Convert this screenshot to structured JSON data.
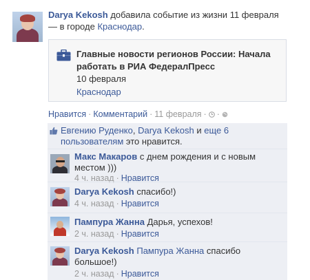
{
  "post": {
    "author": "Darya Kekosh",
    "action": "добавила событие из жизни",
    "date": "11 февраля",
    "location_prefix": "— в городе",
    "city": "Краснодар"
  },
  "event": {
    "icon": "briefcase-icon",
    "title": "Главные новости регионов России: Начала работать в РИА ФедералПресс",
    "date": "10 февраля",
    "location": "Краснодар"
  },
  "actions": {
    "like": "Нравится",
    "comment": "Комментарий",
    "date": "11 февраля"
  },
  "likes": {
    "name1": "Евгению Руденко",
    "name2": "Darya Kekosh",
    "and_word": "и",
    "more": "еще 6 пользователям",
    "suffix": "это нравится."
  },
  "comments": [
    {
      "author": "Макс Макаров",
      "text": "с днем рождения и с новым местом )))",
      "time": "4 ч. назад",
      "like": "Нравится"
    },
    {
      "author": "Darya Kekosh",
      "text": "спасибо!)",
      "time": "4 ч. назад",
      "like": "Нравится"
    },
    {
      "author": "Пампура Жанна",
      "text": "Дарья, успехов!",
      "time": "2 ч. назад",
      "like": "Нравится"
    },
    {
      "author": "Darya Kekosh",
      "mention": "Пампура Жанна",
      "text": "спасибо большое!)",
      "time": "2 ч. назад",
      "like": "Нравится"
    }
  ],
  "colors": {
    "link": "#3b5998",
    "meta": "#999999",
    "ufi_bg": "#edeff4",
    "card_bg": "#f7f7f7"
  }
}
